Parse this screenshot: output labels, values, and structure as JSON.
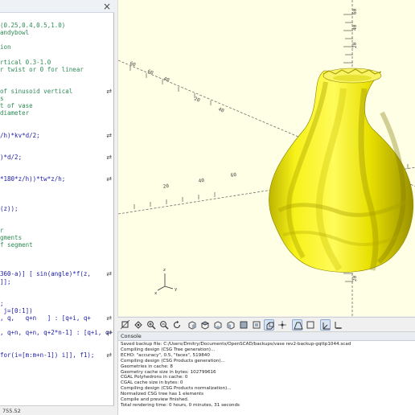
{
  "editor": {
    "close_glyph": "×",
    "lines": [
      {
        "text": "(0.25,0.4,0.5,1.0)",
        "kind": "comment"
      },
      {
        "text": "andybowl",
        "kind": "comment"
      },
      {
        "text": "",
        "kind": "code"
      },
      {
        "text": "ion",
        "kind": "comment"
      },
      {
        "text": "",
        "kind": "code"
      },
      {
        "text": "rtical 0.3-1.0",
        "kind": "comment"
      },
      {
        "text": "r twist or 0 for linear",
        "kind": "comment"
      },
      {
        "text": "",
        "kind": "code"
      },
      {
        "text": "",
        "kind": "code"
      },
      {
        "text": "of sinusoid vertical",
        "kind": "comment",
        "fold": "⇄"
      },
      {
        "text": "s",
        "kind": "comment"
      },
      {
        "text": "t of vase",
        "kind": "comment"
      },
      {
        "text": "diameter",
        "kind": "comment"
      },
      {
        "text": "",
        "kind": "code"
      },
      {
        "text": "",
        "kind": "code"
      },
      {
        "text": "/h)*kv*d/2;",
        "kind": "code",
        "fold": "⇄"
      },
      {
        "text": "",
        "kind": "code"
      },
      {
        "text": "",
        "kind": "code"
      },
      {
        "text": ")*d/2;",
        "kind": "code",
        "fold": "⇄"
      },
      {
        "text": "",
        "kind": "code"
      },
      {
        "text": "",
        "kind": "code"
      },
      {
        "text": "*180*z/h))*tw*z/h;",
        "kind": "code",
        "fold": "⇄"
      },
      {
        "text": "",
        "kind": "code"
      },
      {
        "text": "",
        "kind": "code"
      },
      {
        "text": "",
        "kind": "code"
      },
      {
        "text": "(z));",
        "kind": "code"
      },
      {
        "text": "",
        "kind": "code"
      },
      {
        "text": "",
        "kind": "code"
      },
      {
        "text": "r",
        "kind": "comment"
      },
      {
        "text": "gments",
        "kind": "comment"
      },
      {
        "text": "f segment",
        "kind": "comment"
      },
      {
        "text": "",
        "kind": "code"
      },
      {
        "text": "",
        "kind": "code"
      },
      {
        "text": "",
        "kind": "code"
      },
      {
        "text": "360-a)] [ sin(angle)*f(z,",
        "kind": "code",
        "fold": "⇄"
      },
      {
        "text": "]];",
        "kind": "code"
      },
      {
        "text": "",
        "kind": "code"
      },
      {
        "text": "",
        "kind": "code"
      },
      {
        "text": ";",
        "kind": "code"
      },
      {
        "text": " j=[0:1])",
        "kind": "code"
      },
      {
        "text": ", q,   q+n   ] : [q+i, q+",
        "kind": "code",
        "fold": "⇄"
      },
      {
        "text": "",
        "kind": "code"
      },
      {
        "text": ", q+n, q+n, q+2*n-1] : [q+i, q+",
        "kind": "code",
        "fold": "⇄"
      },
      {
        "text": "",
        "kind": "code"
      },
      {
        "text": "",
        "kind": "code"
      },
      {
        "text": "for(i=[m:m+n-1]) i]], f1);",
        "kind": "code",
        "fold": "⇄"
      }
    ],
    "status": "755.52"
  },
  "viewport": {
    "background": "#ffffe5",
    "model_color": "#f2ee1a",
    "axis_labels": [
      {
        "text": "60",
        "name": "axis-label-y-far-1"
      },
      {
        "text": "60",
        "name": "axis-label-y-far-2"
      },
      {
        "text": "40",
        "name": "axis-label-y-far-3"
      },
      {
        "text": "20",
        "name": "axis-label-x-neg-1"
      },
      {
        "text": "40",
        "name": "axis-label-x-neg-2"
      },
      {
        "text": "60",
        "name": "axis-label-x-neg-3"
      },
      {
        "text": "20",
        "name": "axis-label-y-near-1"
      },
      {
        "text": "40",
        "name": "axis-label-y-near-2"
      },
      {
        "text": "20",
        "name": "axis-label-x-pos-1"
      },
      {
        "text": "40",
        "name": "axis-label-x-pos-2"
      },
      {
        "text": "60",
        "name": "axis-label-x-pos-3"
      },
      {
        "text": "20",
        "name": "axis-label-z-1"
      },
      {
        "text": "40",
        "name": "axis-label-z-2"
      },
      {
        "text": "60",
        "name": "axis-label-z-3"
      },
      {
        "text": "20",
        "name": "axis-label-z-neg-1"
      }
    ],
    "gizmo": {
      "x": "x",
      "y": "y",
      "z": "z"
    }
  },
  "toolbar": {
    "buttons": [
      {
        "name": "view-all-button-icon",
        "active": false
      },
      {
        "name": "reset-view-button-icon",
        "active": false
      },
      {
        "name": "zoom-in-button-icon",
        "active": false
      },
      {
        "name": "zoom-out-button-icon",
        "active": false
      },
      {
        "name": "rotate-view-button-icon",
        "active": false
      },
      {
        "name": "view-right-button-icon",
        "active": false
      },
      {
        "name": "view-top-button-icon",
        "active": false
      },
      {
        "name": "view-bottom-button-icon",
        "active": false
      },
      {
        "name": "view-left-button-icon",
        "active": false
      },
      {
        "name": "view-front-button-icon",
        "active": false
      },
      {
        "name": "view-back-button-icon",
        "active": false
      },
      {
        "name": "view-diagonal-button-icon",
        "active": true
      },
      {
        "name": "view-center-button-icon",
        "active": false
      },
      {
        "name": "perspective-button-icon",
        "active": true
      },
      {
        "name": "orthogonal-button-icon",
        "active": false
      },
      {
        "name": "show-axes-button-icon",
        "active": true
      },
      {
        "name": "show-scale-markers-button-icon",
        "active": false
      }
    ]
  },
  "console": {
    "title": "Console",
    "lines": [
      "Saved backup file: C:/Users/Dmitry/Documents/OpenSCAD/backups/vase rev2-backup-gqttp1044.scad",
      "Compiling design (CSG Tree generation)...",
      "ECHO: \"accuracy\", 0.5, \"faces\", 519840",
      "Compiling design (CSG Products generation)...",
      "Geometries in cache: 8",
      "Geometry cache size in bytes: 102799616",
      "CGAL Polyhedrons in cache: 0",
      "CGAL cache size in bytes: 0",
      "Compiling design (CSG Products normalization)...",
      "Normalized CSG tree has 1 elements",
      "Compile and preview finished.",
      "Total rendering time: 0 hours, 0 minutes, 31 seconds"
    ]
  }
}
